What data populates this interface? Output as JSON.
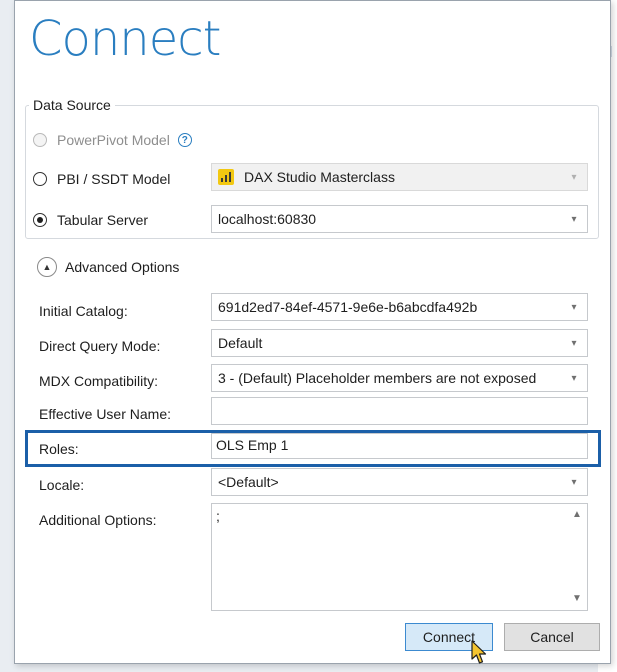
{
  "dialog": {
    "title": "Connect"
  },
  "data_source": {
    "legend": "Data Source",
    "powerpivot_label": "PowerPivot Model",
    "help_glyph": "?",
    "pbi_label": "PBI / SSDT Model",
    "pbi_value": "DAX Studio Masterclass",
    "tabular_label": "Tabular Server",
    "tabular_value": "localhost:60830",
    "selected": "Tabular Server"
  },
  "advanced": {
    "label": "Advanced Options",
    "initial_catalog_label": "Initial Catalog:",
    "initial_catalog_value": "691d2ed7-84ef-4571-9e6e-b6abcdfa492b",
    "direct_query_label": "Direct Query Mode:",
    "direct_query_value": "Default",
    "mdx_label": "MDX Compatibility:",
    "mdx_value": "3 - (Default) Placeholder members are not exposed",
    "effective_user_label": "Effective User Name:",
    "effective_user_value": "",
    "roles_label": "Roles:",
    "roles_value": "OLS Emp 1",
    "locale_label": "Locale:",
    "locale_value": "<Default>",
    "additional_label": "Additional Options:",
    "additional_value": ";"
  },
  "buttons": {
    "connect": "Connect",
    "cancel": "Cancel"
  },
  "colors": {
    "title": "#2a7ec0",
    "highlight_border": "#1b5fa8",
    "primary_button": "#d6e9f8",
    "pbi_icon": "#f2c811"
  },
  "icons": {
    "help": "help-icon",
    "expand": "chevron-up-icon",
    "dropdown": "chevron-down-icon",
    "pbi": "power-bi-icon",
    "cursor": "mouse-cursor-icon"
  }
}
